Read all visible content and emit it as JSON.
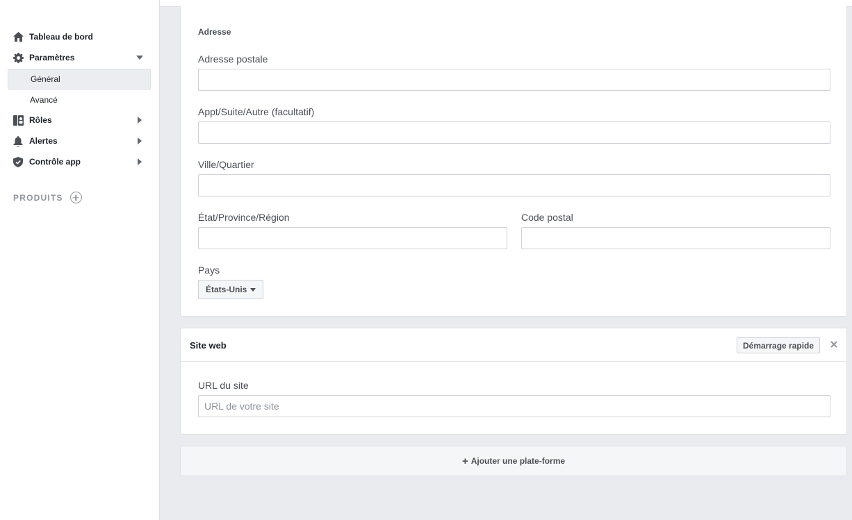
{
  "sidebar": {
    "items": [
      {
        "label": "Tableau de bord",
        "icon": "home-icon"
      },
      {
        "label": "Paramètres",
        "icon": "gear-icon",
        "expanded": true
      },
      {
        "label": "Rôles",
        "icon": "roles-icon"
      },
      {
        "label": "Alertes",
        "icon": "bell-icon"
      },
      {
        "label": "Contrôle app",
        "icon": "shield-icon"
      }
    ],
    "sub_items": [
      {
        "label": "Général",
        "active": true
      },
      {
        "label": "Avancé",
        "active": false
      }
    ],
    "products_label": "PRODUITS"
  },
  "address": {
    "title": "Adresse",
    "street_label": "Adresse postale",
    "street_value": "",
    "apt_label": "Appt/Suite/Autre (facultatif)",
    "apt_value": "",
    "city_label": "Ville/Quartier",
    "city_value": "",
    "state_label": "État/Province/Région",
    "state_value": "",
    "zip_label": "Code postal",
    "zip_value": "",
    "country_label": "Pays",
    "country_value": "États-Unis"
  },
  "website": {
    "title": "Site web",
    "quick_start": "Démarrage rapide",
    "url_label": "URL du site",
    "url_placeholder": "URL de votre site",
    "url_value": ""
  },
  "add_platform": "Ajouter une plate-forme",
  "colors": {
    "background": "#e9ebee",
    "border": "#dddfe2",
    "text": "#1d2129",
    "muted": "#90949c"
  }
}
